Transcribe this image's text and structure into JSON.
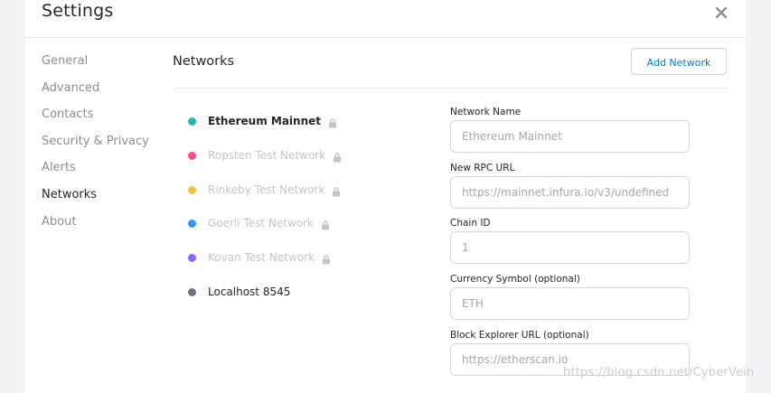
{
  "header": {
    "title": "Settings"
  },
  "sidebar": {
    "items": [
      {
        "label": "General",
        "active": false
      },
      {
        "label": "Advanced",
        "active": false
      },
      {
        "label": "Contacts",
        "active": false
      },
      {
        "label": "Security & Privacy",
        "active": false
      },
      {
        "label": "Alerts",
        "active": false
      },
      {
        "label": "Networks",
        "active": true
      },
      {
        "label": "About",
        "active": false
      }
    ]
  },
  "main": {
    "title": "Networks",
    "add_network_label": "Add Network",
    "networks": [
      {
        "name": "Ethereum Mainnet",
        "color": "#29b6af",
        "locked": true
      },
      {
        "name": "Ropsten Test Network",
        "color": "#ff4a8d",
        "locked": true
      },
      {
        "name": "Rinkeby Test Network",
        "color": "#f6c343",
        "locked": true
      },
      {
        "name": "Goerli Test Network",
        "color": "#3099f2",
        "locked": true
      },
      {
        "name": "Kovan Test Network",
        "color": "#9064ff",
        "locked": true
      },
      {
        "name": "Localhost 8545",
        "color": "#6a737d",
        "locked": false
      }
    ],
    "form": {
      "network_name_label": "Network Name",
      "network_name_value": "Ethereum Mainnet",
      "rpc_url_label": "New RPC URL",
      "rpc_url_value": "https://mainnet.infura.io/v3/undefined",
      "chain_id_label": "Chain ID",
      "chain_id_value": "1",
      "currency_symbol_label": "Currency Symbol (optional)",
      "currency_symbol_value": "ETH",
      "block_explorer_label": "Block Explorer URL (optional)",
      "block_explorer_value": "https://etherscan.io"
    }
  },
  "watermark": "https://blog.csdn.net/CyberVein",
  "colors": {
    "accent": "#037dd6",
    "lock": "#c2c5c9"
  }
}
